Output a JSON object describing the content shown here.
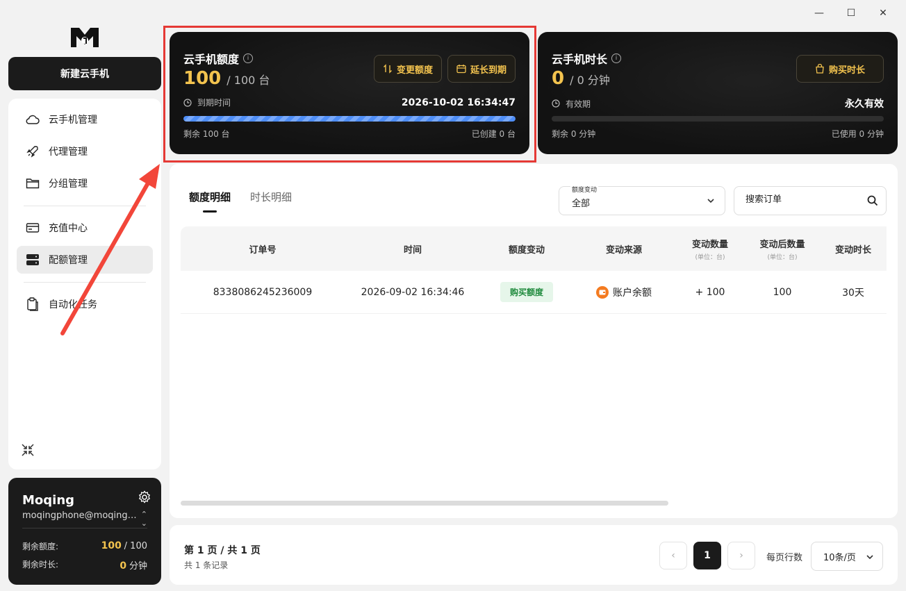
{
  "window": {
    "min": "—",
    "max": "☐",
    "close": "✕"
  },
  "sidebar": {
    "new_button": "新建云手机",
    "items": [
      {
        "label": "云手机管理",
        "icon": "cloud-icon"
      },
      {
        "label": "代理管理",
        "icon": "rocket-icon"
      },
      {
        "label": "分组管理",
        "icon": "folder-icon"
      },
      {
        "label": "充值中心",
        "icon": "card-icon"
      },
      {
        "label": "配额管理",
        "icon": "server-icon",
        "active": true
      },
      {
        "label": "自动化任务",
        "icon": "clipboard-icon"
      }
    ]
  },
  "user": {
    "name": "Moqing",
    "email": "moqingphone@moqing.com",
    "quota_label": "剩余额度:",
    "quota_value": "100",
    "quota_total": "/ 100",
    "time_label": "剩余时长:",
    "time_value": "0",
    "time_unit": "分钟"
  },
  "quota_card": {
    "title": "云手机额度",
    "value": "100",
    "total": "/ 100 台",
    "btn_change": "变更额度",
    "btn_extend": "延长到期",
    "expire_label": "到期时间",
    "expire_value": "2026-10-02 16:34:47",
    "progress": 1.0,
    "remaining": "剩余 100 台",
    "created": "已创建 0 台"
  },
  "time_card": {
    "title": "云手机时长",
    "value": "0",
    "total": "/ 0 分钟",
    "btn_buy": "购买时长",
    "validity_label": "有效期",
    "validity_value": "永久有效",
    "progress": 0,
    "remaining": "剩余 0 分钟",
    "used": "已使用 0 分钟"
  },
  "main": {
    "tabs": [
      {
        "label": "额度明细",
        "active": true
      },
      {
        "label": "时长明细"
      }
    ],
    "filter": {
      "label": "额度变动",
      "value": "全部"
    },
    "search": {
      "placeholder": "搜索订单"
    },
    "columns": [
      {
        "label": "订单号"
      },
      {
        "label": "时间"
      },
      {
        "label": "额度变动"
      },
      {
        "label": "变动来源"
      },
      {
        "label": "变动数量",
        "sub": "(单位：台)"
      },
      {
        "label": "变动后数量",
        "sub": "(单位：台)"
      },
      {
        "label": "变动时长"
      }
    ],
    "rows": [
      {
        "order": "8338086245236009",
        "time": "2026-09-02 16:34:46",
        "change": "购买额度",
        "source": "账户余额",
        "amount": "+ 100",
        "after": "100",
        "duration": "30天"
      }
    ]
  },
  "pager": {
    "info": "第 1 页 / 共 1 页",
    "sub": "共 1 条记录",
    "prev": "‹",
    "current": "1",
    "next": "›",
    "rows_label": "每页行数",
    "rows_value": "10条/页"
  },
  "colors": {
    "accent_gold": "#f3c34e",
    "progress_blue": "#4f8ef7",
    "annotation_red": "#e53935",
    "badge_green": "#1f8a3d"
  }
}
